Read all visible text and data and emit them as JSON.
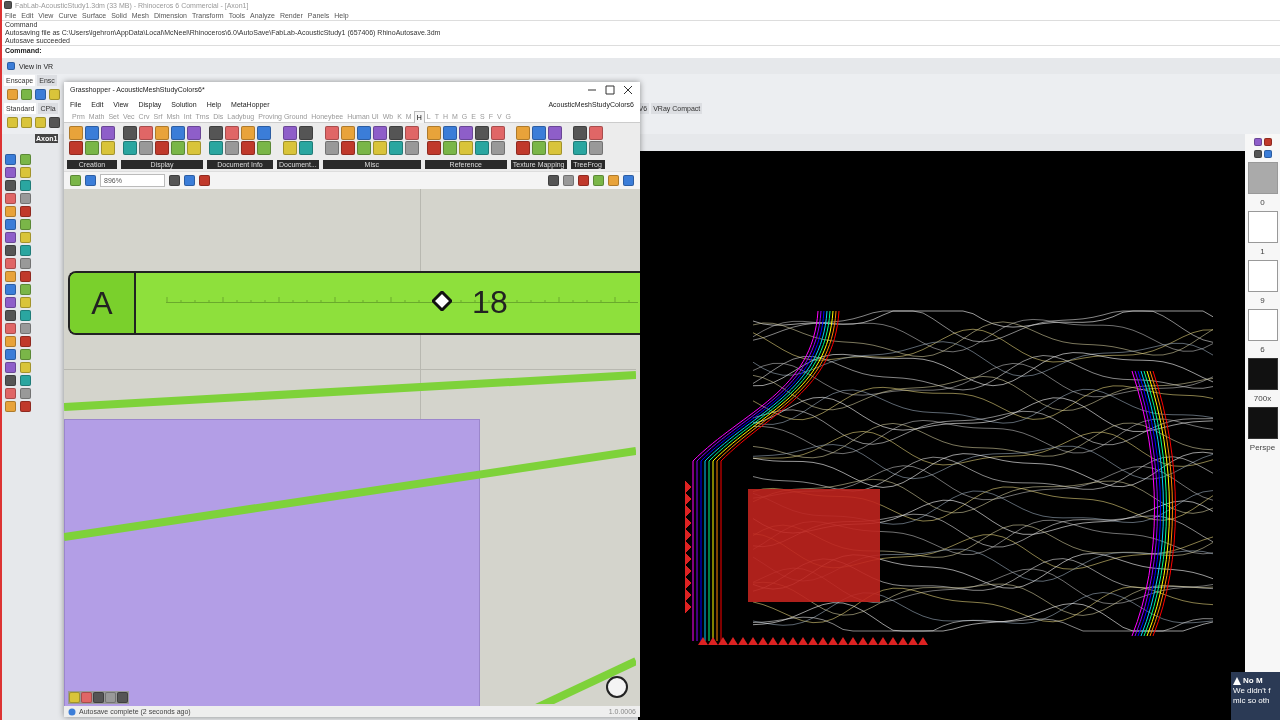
{
  "rhino": {
    "title": "FabLab-AcousticStudy1.3dm (33 MB) - Rhinoceros 6 Commercial - [Axon1]",
    "menu": [
      "File",
      "Edit",
      "View",
      "Curve",
      "Surface",
      "Solid",
      "Mesh",
      "Dimension",
      "Transform",
      "Tools",
      "Analyze",
      "Render",
      "Panels",
      "Help"
    ],
    "command_log": [
      "Command",
      "Autosaving file as C:\\Users\\lgehron\\AppData\\Local\\McNeel\\Rhinoceros\\6.0\\AutoSave\\FabLab-AcousticStudy1 (657406) RhinoAutosave.3dm",
      "Autosave succeeded"
    ],
    "prompt": "Command:",
    "vr_button": "View in VR",
    "toolbar_tabs": [
      {
        "label": "Enscape",
        "selected": true
      },
      {
        "label": "Ensc",
        "selected": false
      }
    ],
    "toolbar_tabs_2": [
      {
        "label": "Standard",
        "selected": true
      },
      {
        "label": "CPla",
        "selected": false
      }
    ],
    "toolbar_tabs_3": [
      {
        "label": "V6",
        "selected": false
      },
      {
        "label": "VRay Compact",
        "selected": false
      }
    ],
    "viewport_tab": "Axon1"
  },
  "grasshopper": {
    "title": "Grasshopper - AcousticMeshStudyColors6*",
    "menu": [
      "File",
      "Edit",
      "View",
      "Display",
      "Solution",
      "Help",
      "MetaHopper"
    ],
    "document_name": "AcousticMeshStudyColors6",
    "tabs": [
      {
        "label": "Prm",
        "selected": false
      },
      {
        "label": "Math",
        "selected": false
      },
      {
        "label": "Set",
        "selected": false
      },
      {
        "label": "Vec",
        "selected": false
      },
      {
        "label": "Crv",
        "selected": false
      },
      {
        "label": "Srf",
        "selected": false
      },
      {
        "label": "Msh",
        "selected": false
      },
      {
        "label": "Int",
        "selected": false
      },
      {
        "label": "Trns",
        "selected": false
      },
      {
        "label": "Dis",
        "selected": false
      },
      {
        "label": "Ladybug",
        "selected": false
      },
      {
        "label": "Proving Ground",
        "selected": false
      },
      {
        "label": "Honeybee",
        "selected": false
      },
      {
        "label": "Human UI",
        "selected": false
      },
      {
        "label": "Wb",
        "selected": false
      },
      {
        "label": "K",
        "selected": false
      },
      {
        "label": "M",
        "selected": false
      },
      {
        "label": "H",
        "selected": true
      },
      {
        "label": "L",
        "selected": false
      },
      {
        "label": "T",
        "selected": false
      },
      {
        "label": "H",
        "selected": false
      },
      {
        "label": "M",
        "selected": false
      },
      {
        "label": "G",
        "selected": false
      },
      {
        "label": "E",
        "selected": false
      },
      {
        "label": "S",
        "selected": false
      },
      {
        "label": "F",
        "selected": false
      },
      {
        "label": "V",
        "selected": false
      },
      {
        "label": "G",
        "selected": false
      }
    ],
    "groups": [
      "Creation",
      "Display",
      "Document Info",
      "Document...",
      "Misc",
      "Reference",
      "Texture Mapping",
      "TreeFrog"
    ],
    "zoom": "896%",
    "slider": {
      "name": "A",
      "value": "18",
      "level": 0.58
    },
    "status": "Autosave complete (2 seconds ago)",
    "version": "1.0.0006"
  },
  "right_panel": {
    "thumbnails": [
      {
        "label": "0",
        "kind": "gray"
      },
      {
        "label": "1",
        "kind": "blank"
      },
      {
        "label": "9",
        "kind": "blank"
      },
      {
        "label": "6",
        "kind": "blank"
      },
      {
        "label": "700x",
        "kind": "plan"
      },
      {
        "label": "Perspe",
        "kind": "perspective"
      }
    ],
    "notification": {
      "title": "No M",
      "lines": [
        "We didn't f",
        "mic so oth"
      ]
    }
  }
}
